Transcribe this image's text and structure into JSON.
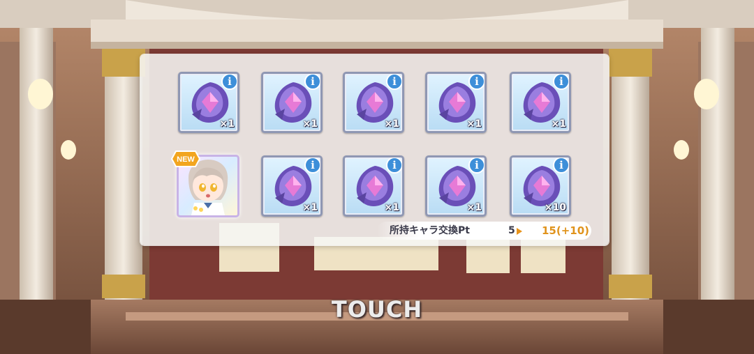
{
  "colors": {
    "panel": "#f6f6f4",
    "frame": "#8f97b3",
    "info": "#3d8fd9",
    "accent": "#e0931c"
  },
  "rewards": [
    {
      "icon": "memory-piece-icon",
      "qty": "×1"
    },
    {
      "icon": "memory-piece-icon",
      "qty": "×1"
    },
    {
      "icon": "memory-piece-icon",
      "qty": "×1"
    },
    {
      "icon": "memory-piece-icon",
      "qty": "×1"
    },
    {
      "icon": "memory-piece-icon",
      "qty": "×1"
    },
    {
      "icon": "character-portrait",
      "badge": "NEW"
    },
    {
      "icon": "memory-piece-icon",
      "qty": "×1"
    },
    {
      "icon": "memory-piece-icon",
      "qty": "×1"
    },
    {
      "icon": "memory-piece-icon",
      "qty": "×1"
    },
    {
      "icon": "memory-piece-icon",
      "qty": "×10"
    }
  ],
  "info_glyph": "i",
  "exchange": {
    "label": "所持キャラ交換Pt",
    "current": "5",
    "new_value": "15(+10)"
  },
  "touch_label": "TOUCH"
}
